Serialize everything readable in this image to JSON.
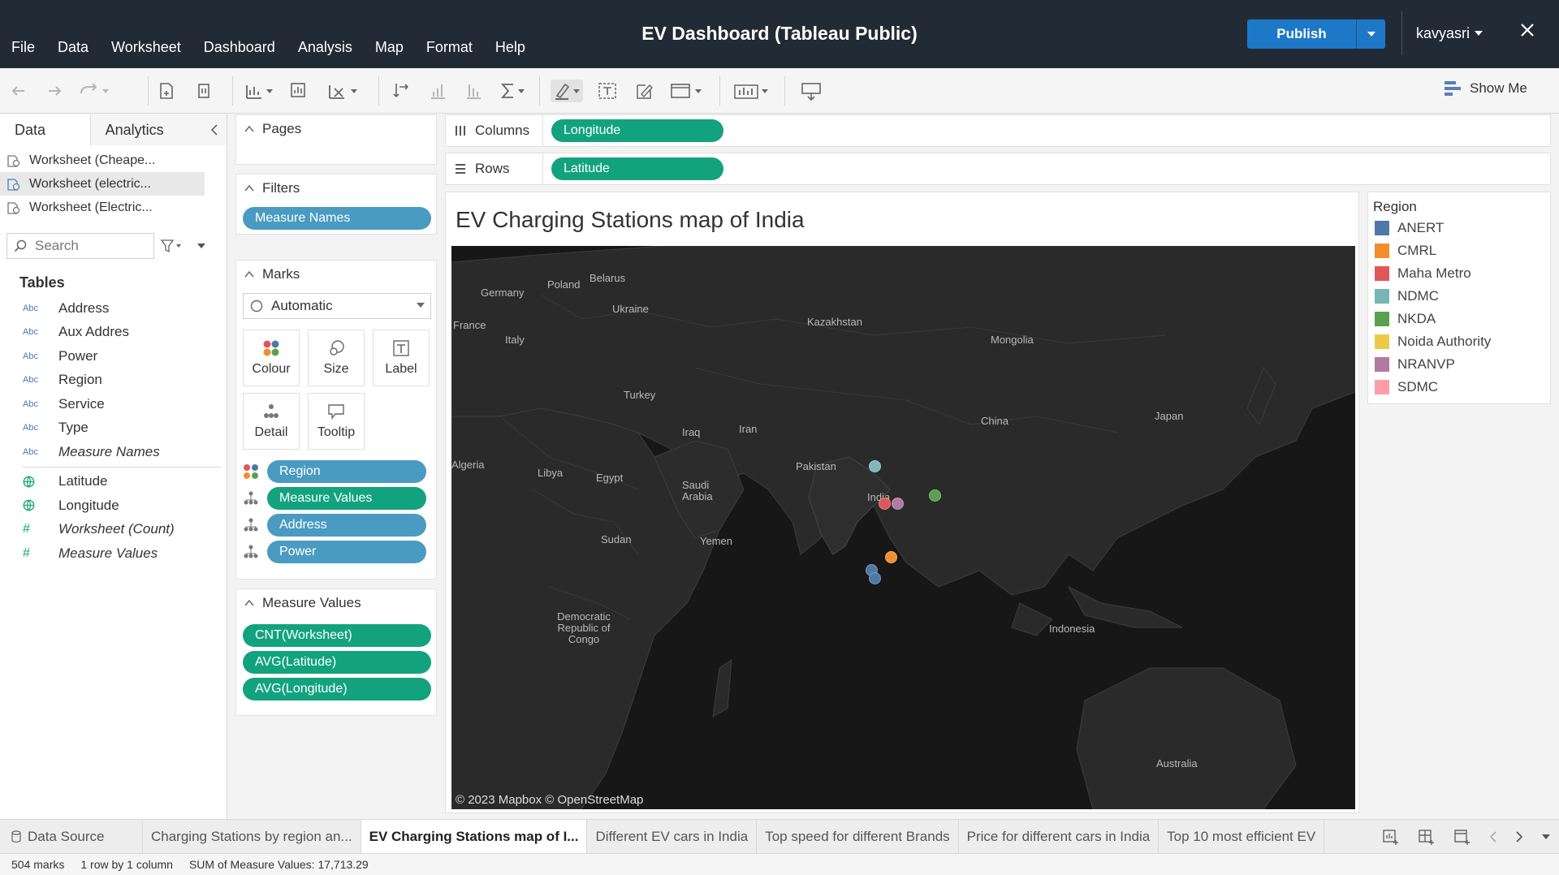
{
  "app": {
    "title": "EV Dashboard (Tableau Public)",
    "user": "kavyasri",
    "publish_label": "Publish"
  },
  "menu": [
    "File",
    "Data",
    "Worksheet",
    "Dashboard",
    "Analysis",
    "Map",
    "Format",
    "Help"
  ],
  "toolbar": {
    "show_me_label": "Show Me"
  },
  "data_pane": {
    "tabs": {
      "data": "Data",
      "analytics": "Analytics"
    },
    "data_sources": [
      "Worksheet (Cheape...",
      "Worksheet (electric...",
      "Worksheet (Electric..."
    ],
    "active_source_index": 1,
    "search_placeholder": "Search",
    "tables_heading": "Tables",
    "dimensions": [
      {
        "type": "Abc",
        "name": "Address"
      },
      {
        "type": "Abc",
        "name": "Aux Addres"
      },
      {
        "type": "Abc",
        "name": "Power"
      },
      {
        "type": "Abc",
        "name": "Region"
      },
      {
        "type": "Abc",
        "name": "Service"
      },
      {
        "type": "Abc",
        "name": "Type"
      },
      {
        "type": "Abc",
        "name": "Measure Names"
      }
    ],
    "measures": [
      {
        "type": "globe",
        "name": "Latitude"
      },
      {
        "type": "globe",
        "name": "Longitude"
      },
      {
        "type": "#",
        "name": "Worksheet (Count)"
      },
      {
        "type": "#",
        "name": "Measure Values"
      }
    ]
  },
  "shelves": {
    "pages_label": "Pages",
    "filters_label": "Filters",
    "filters": [
      "Measure Names"
    ],
    "marks_label": "Marks",
    "marks_type": "Automatic",
    "mark_buttons": {
      "colour": "Colour",
      "size": "Size",
      "label": "Label",
      "detail": "Detail",
      "tooltip": "Tooltip"
    },
    "mark_pills": [
      "Region",
      "Measure Values",
      "Address",
      "Power"
    ],
    "measure_values_label": "Measure Values",
    "measure_values": [
      "CNT(Worksheet)",
      "AVG(Latitude)",
      "AVG(Longitude)"
    ],
    "columns_label": "Columns",
    "columns_pill": "Longitude",
    "rows_label": "Rows",
    "rows_pill": "Latitude"
  },
  "viz": {
    "title": "EV Charging Stations map of India",
    "map_credit": "© 2023 Mapbox © OpenStreetMap",
    "map_labels": [
      "Germany",
      "Poland",
      "Belarus",
      "Ukraine",
      "France",
      "Italy",
      "Kazakhstan",
      "Mongolia",
      "Turkey",
      "Iraq",
      "Iran",
      "China",
      "Japan",
      "Algeria",
      "Libya",
      "Egypt",
      "Saudi Arabia",
      "Pakistan",
      "India",
      "Sudan",
      "Yemen",
      "Democratic Republic of Congo",
      "Indonesia",
      "Australia"
    ],
    "points": [
      {
        "region": "NDMC",
        "color": "#7fb8b7"
      },
      {
        "region": "Maha Metro",
        "color": "#e05759"
      },
      {
        "region": "NRANVP",
        "color": "#b07aa1"
      },
      {
        "region": "NKDA",
        "color": "#59a14f"
      },
      {
        "region": "CMRL",
        "color": "#f28e2b"
      },
      {
        "region": "ANERT",
        "color": "#4e79a7"
      },
      {
        "region": "ANERT",
        "color": "#4e79a7"
      }
    ]
  },
  "legend": {
    "title": "Region",
    "items": [
      {
        "label": "ANERT",
        "color": "#4e79a7"
      },
      {
        "label": "CMRL",
        "color": "#f28e2b"
      },
      {
        "label": "Maha Metro",
        "color": "#e15759"
      },
      {
        "label": "NDMC",
        "color": "#76b7b2"
      },
      {
        "label": "NKDA",
        "color": "#59a14f"
      },
      {
        "label": "Noida Authority",
        "color": "#edc948"
      },
      {
        "label": "NRANVP",
        "color": "#b07aa1"
      },
      {
        "label": "SDMC",
        "color": "#ff9da7"
      }
    ]
  },
  "sheet_tabs": {
    "data_source": "Data Source",
    "tabs": [
      "Charging Stations by region an...",
      "EV Charging Stations map of I...",
      "Different EV cars in India",
      "Top speed for different Brands",
      "Price for different cars in India",
      "Top 10 most efficient EV"
    ],
    "active_index": 1
  },
  "status": {
    "marks": "504 marks",
    "dims": "1 row by 1 column",
    "sum": "SUM of Measure Values: 17,713.29"
  }
}
